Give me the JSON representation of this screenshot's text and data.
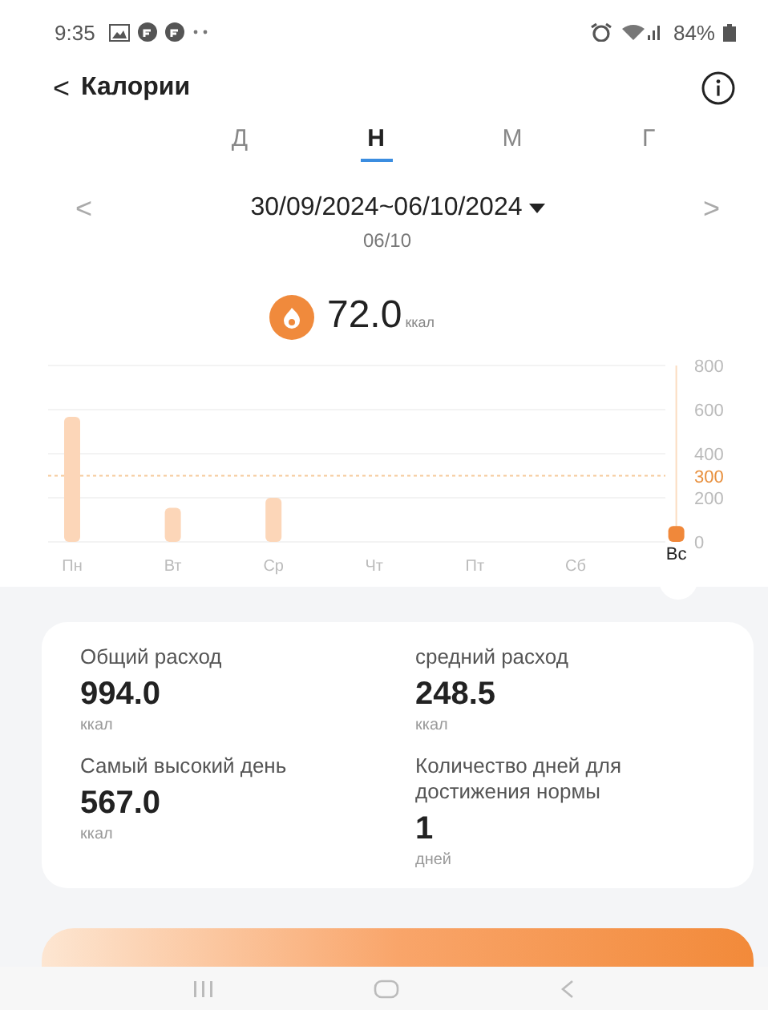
{
  "status_bar": {
    "time": "9:35",
    "battery": "84%"
  },
  "header": {
    "back": "<",
    "title": "Калории"
  },
  "tabs": [
    {
      "label": "Д",
      "selected": false
    },
    {
      "label": "Н",
      "selected": true
    },
    {
      "label": "М",
      "selected": false
    },
    {
      "label": "Г",
      "selected": false
    }
  ],
  "date_nav": {
    "prev": "<",
    "range": "30/09/2024~06/10/2024",
    "next": ">",
    "day": "06/10"
  },
  "current": {
    "value": "72.0",
    "unit": "ккал"
  },
  "chart_data": {
    "type": "bar",
    "categories": [
      "Пн",
      "Вт",
      "Ср",
      "Чт",
      "Пт",
      "Сб",
      "Вс"
    ],
    "values": [
      567,
      155,
      200,
      0,
      0,
      0,
      72
    ],
    "ylim": [
      0,
      800
    ],
    "yticks": [
      0,
      200,
      400,
      600,
      800
    ],
    "grid": true,
    "ref_lines": [
      {
        "axis": "y",
        "value": 300,
        "label": "300"
      }
    ]
  },
  "chart_days": [
    {
      "selected": false
    },
    {
      "selected": false
    },
    {
      "selected": false
    },
    {
      "selected": false
    },
    {
      "selected": false
    },
    {
      "selected": false
    },
    {
      "selected": true
    }
  ],
  "stats": [
    {
      "label": "Общий расход",
      "value": "994.0",
      "unit": "ккал"
    },
    {
      "label": "средний расход",
      "value": "248.5",
      "unit": "ккал"
    },
    {
      "label": "Самый высокий день",
      "value": "567.0",
      "unit": "ккал"
    },
    {
      "label": "Количество дней для достижения нормы",
      "value": "1",
      "unit": "дней"
    }
  ]
}
